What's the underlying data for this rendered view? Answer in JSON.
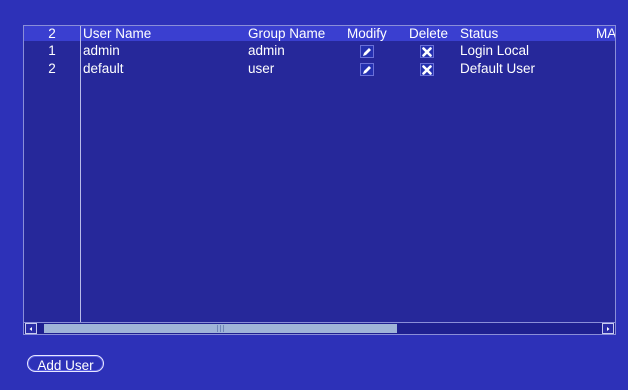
{
  "table": {
    "header": {
      "count": "2",
      "user_name": "User Name",
      "group_name": "Group Name",
      "modify": "Modify",
      "delete": "Delete",
      "status": "Status",
      "mac": "MA"
    },
    "rows": [
      {
        "index": "1",
        "user_name": "admin",
        "group_name": "admin",
        "modify_icon": "pencil-icon",
        "delete_icon": "x-icon",
        "status": "Login Local"
      },
      {
        "index": "2",
        "user_name": "default",
        "group_name": "user",
        "modify_icon": "pencil-icon",
        "delete_icon": "x-icon",
        "status": "Default User"
      }
    ]
  },
  "scrollbar": {
    "left_arrow": "scroll-left-icon",
    "right_arrow": "scroll-right-icon",
    "position": 0
  },
  "actions": {
    "add_user_label": "Add User"
  },
  "colors": {
    "background": "#2d31b8",
    "table_background": "#26289a",
    "header_background": "#3a3fd0",
    "text": "#ffffff"
  }
}
